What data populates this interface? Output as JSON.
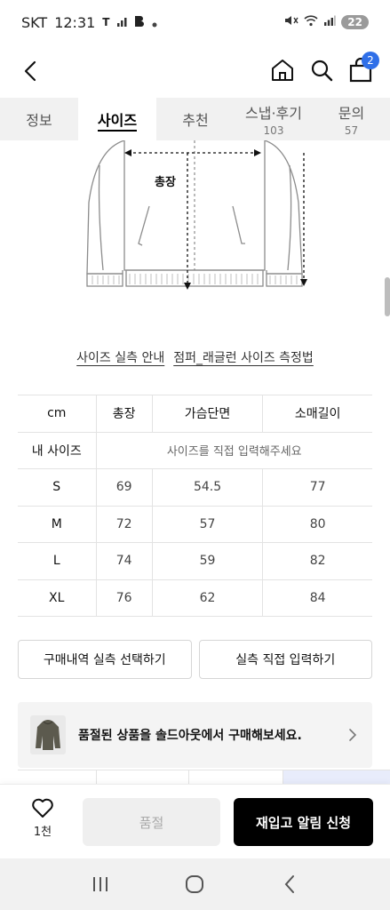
{
  "status_bar": {
    "carrier": "SKT",
    "time": "12:31",
    "indicators": "T",
    "battery": "22"
  },
  "header": {
    "cart_count": "2"
  },
  "tabs": [
    {
      "label": "정보",
      "count": ""
    },
    {
      "label": "사이즈",
      "count": ""
    },
    {
      "label": "추천",
      "count": ""
    },
    {
      "label": "스냅·후기",
      "count": "103"
    },
    {
      "label": "문의",
      "count": "57"
    }
  ],
  "diagram": {
    "length_label": "총장"
  },
  "guide_links": {
    "size_guide": "사이즈 실측 안내",
    "measure_method": "점퍼_래글런 사이즈 측정법"
  },
  "size_table": {
    "headers": [
      "cm",
      "총장",
      "가슴단면",
      "소매길이"
    ],
    "my_size_label": "내 사이즈",
    "my_size_hint": "사이즈를 직접 입력해주세요",
    "rows": [
      {
        "size": "S",
        "length": "69",
        "chest": "54.5",
        "sleeve": "77"
      },
      {
        "size": "M",
        "length": "72",
        "chest": "57",
        "sleeve": "80"
      },
      {
        "size": "L",
        "length": "74",
        "chest": "59",
        "sleeve": "82"
      },
      {
        "size": "XL",
        "length": "76",
        "chest": "62",
        "sleeve": "84"
      }
    ]
  },
  "actions": {
    "select_history": "구매내역 실측 선택하기",
    "direct_input": "실측 직접 입력하기"
  },
  "soldout_banner": {
    "text": "품절된 상품을 솔드아웃에서 구매해보세요."
  },
  "purchase_bar": {
    "likes": "1천",
    "soldout_label": "품절",
    "restock_label": "재입고 알림 신청"
  },
  "colors": {
    "accent": "#2f6fe8",
    "primary_button": "#000000",
    "tab_bg": "#f1f1f1"
  }
}
